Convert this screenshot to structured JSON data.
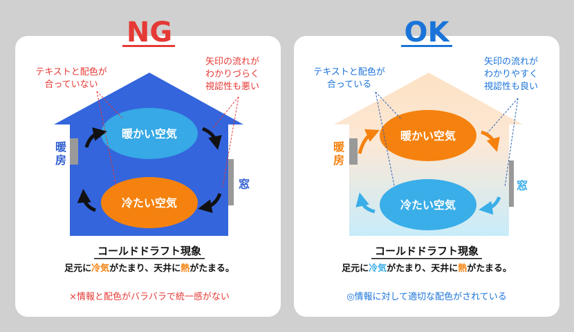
{
  "colors": {
    "background": "#d0d0d0",
    "ng_red": "#e53935",
    "ok_blue": "#1a73d9",
    "ng_house": "#3465dc",
    "ng_warm": "#36a9e6",
    "orange": "#f5820f",
    "ok_cool": "#3aaee8"
  },
  "ng": {
    "heading": "NG",
    "note_left": [
      "テキストと配色が",
      "合っていない"
    ],
    "note_right": [
      "矢印の流れが",
      "わかりづらく",
      "視認性も悪い"
    ],
    "heater_label": [
      "暖",
      "房"
    ],
    "window_label": "窓",
    "warm_air": "暖かい空気",
    "cool_air": "冷たい空気",
    "caption_title": "コールドドラフト現象",
    "caption": {
      "p1": "足元に",
      "cold": "冷気",
      "p2": "がたまり、天井に",
      "heat": "熱",
      "p3": "がたまる。"
    },
    "verdict": "×情報と配色がバラバラで統一感がない"
  },
  "ok": {
    "heading": "OK",
    "note_left": [
      "テキストと配色が",
      "合っている"
    ],
    "note_right": [
      "矢印の流れが",
      "わかりやすく",
      "視認性も良い"
    ],
    "heater_label": [
      "暖",
      "房"
    ],
    "window_label": "窓",
    "warm_air": "暖かい空気",
    "cool_air": "冷たい空気",
    "caption_title": "コールドドラフト現象",
    "caption": {
      "p1": "足元に",
      "cold": "冷気",
      "p2": "がたまり、天井に",
      "heat": "熱",
      "p3": "がたまる。"
    },
    "verdict": "◎情報に対して適切な配色がされている"
  }
}
